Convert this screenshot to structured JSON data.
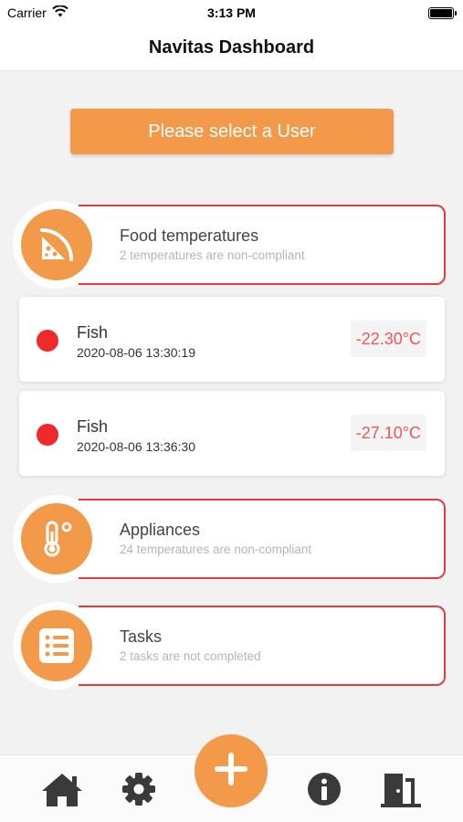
{
  "status_bar": {
    "carrier": "Carrier",
    "time": "3:13 PM"
  },
  "nav": {
    "title": "Navitas Dashboard"
  },
  "select_user": {
    "label": "Please select a User"
  },
  "categories": [
    {
      "title": "Food temperatures",
      "subtitle": "2 temperatures are non-compliant",
      "icon": "pizza-icon"
    },
    {
      "title": "Appliances",
      "subtitle": "24 temperatures are non-compliant",
      "icon": "thermometer-icon"
    },
    {
      "title": "Tasks",
      "subtitle": "2 tasks are not completed",
      "icon": "list-icon"
    }
  ],
  "readings": [
    {
      "name": "Fish",
      "timestamp": "2020-08-06 13:30:19",
      "temperature": "-22.30°C",
      "status": "non-compliant"
    },
    {
      "name": "Fish",
      "timestamp": "2020-08-06 13:36:30",
      "temperature": "-27.10°C",
      "status": "non-compliant"
    }
  ],
  "tab_bar": {
    "items": [
      "home-icon",
      "gear-icon",
      "add-icon",
      "info-icon",
      "logout-icon"
    ]
  },
  "colors": {
    "accent": "#f29a4a",
    "alert": "#e8393f",
    "status_dot": "#f02a2a",
    "temp_text": "#f0565a",
    "icon_dark": "#3a3a3a"
  }
}
